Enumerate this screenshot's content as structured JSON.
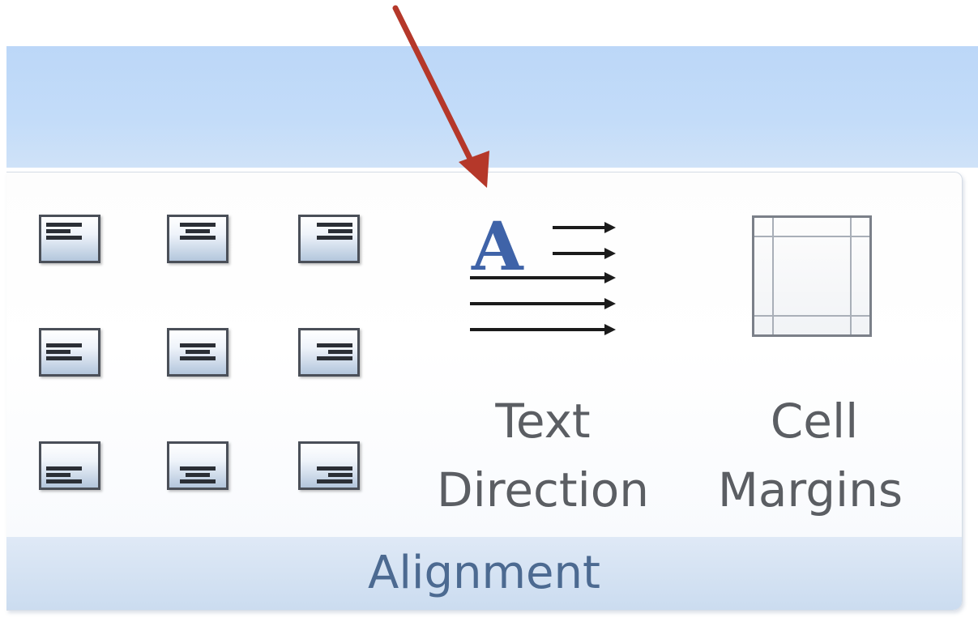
{
  "ribbon": {
    "group": {
      "label": "Alignment",
      "alignment_buttons": [
        {
          "name": "align-top-left",
          "tooltip": ""
        },
        {
          "name": "align-top-center",
          "tooltip": ""
        },
        {
          "name": "align-top-right",
          "tooltip": ""
        },
        {
          "name": "align-middle-left",
          "tooltip": ""
        },
        {
          "name": "align-middle-center",
          "tooltip": ""
        },
        {
          "name": "align-middle-right",
          "tooltip": ""
        },
        {
          "name": "align-bottom-left",
          "tooltip": ""
        },
        {
          "name": "align-bottom-center",
          "tooltip": ""
        },
        {
          "name": "align-bottom-right",
          "tooltip": ""
        }
      ],
      "text_direction": {
        "line1": "Text",
        "line2": "Direction",
        "icon": "text-direction-icon"
      },
      "cell_margins": {
        "line1": "Cell",
        "line2": "Margins",
        "icon": "cell-margins-icon"
      }
    }
  },
  "annotation": {
    "icon": "red-pointer-arrow",
    "color": "#b5382a"
  },
  "colors": {
    "ribbon_blue": "#bcd7f8",
    "group_label_text": "#4c6a91",
    "button_label_text": "#5b5e63",
    "text_direction_letter": "#3f63a8"
  }
}
